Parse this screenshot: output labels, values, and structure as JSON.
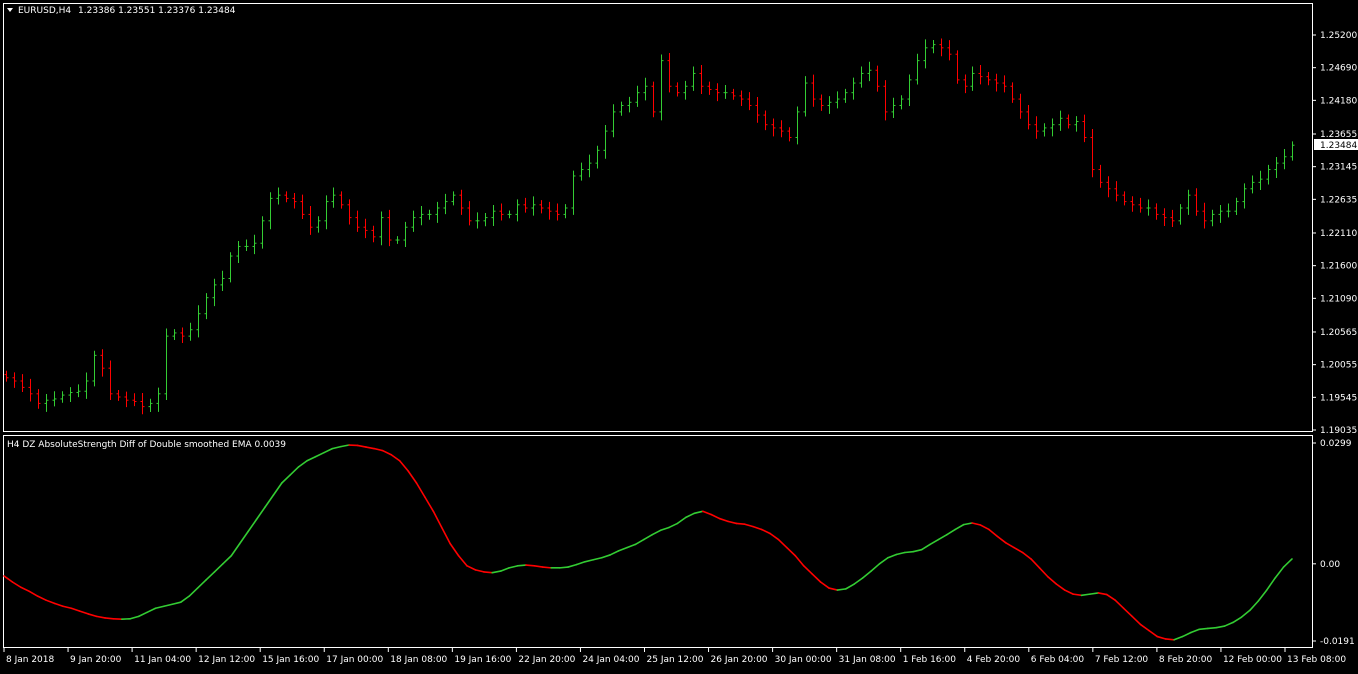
{
  "main_window": {
    "symbol": "EURUSD,H4",
    "ohlc": "1.23386 1.23551 1.23376 1.23484",
    "current_price": "1.23484",
    "price_ticks": [
      "1.25200",
      "1.24690",
      "1.24180",
      "1.23655",
      "1.23145",
      "1.22635",
      "1.22110",
      "1.21600",
      "1.21090",
      "1.20565",
      "1.20055",
      "1.19545",
      "1.19035"
    ]
  },
  "indicator_window": {
    "title": "H4 DZ AbsoluteStrength Diff  of Double smoothed EMA 0.0039",
    "value_ticks": [
      "0.0299",
      "0.00",
      "-0.0191"
    ]
  },
  "time_axis": [
    "8 Jan 2018",
    "9 Jan 20:00",
    "11 Jan 04:00",
    "12 Jan 12:00",
    "15 Jan 16:00",
    "17 Jan 00:00",
    "18 Jan 08:00",
    "19 Jan 16:00",
    "22 Jan 20:00",
    "24 Jan 04:00",
    "25 Jan 12:00",
    "26 Jan 20:00",
    "30 Jan 00:00",
    "31 Jan 08:00",
    "1 Feb 16:00",
    "4 Feb 20:00",
    "6 Feb 04:00",
    "7 Feb 12:00",
    "8 Feb 20:00",
    "12 Feb 00:00",
    "13 Feb 08:00"
  ],
  "colors": {
    "up": "#33cc33",
    "down": "#ff0000",
    "background": "#000000",
    "frame": "#ffffff"
  },
  "chart_data": [
    {
      "type": "bar",
      "description_key": "price",
      "ylim": [
        1.19035,
        1.252
      ],
      "close": [
        1.1985,
        1.198,
        1.197,
        1.196,
        1.1945,
        1.195,
        1.1952,
        1.1958,
        1.1962,
        1.1964,
        1.198,
        1.202,
        1.2,
        1.196,
        1.1955,
        1.195,
        1.1948,
        1.194,
        1.1945,
        1.196,
        1.205,
        1.2055,
        1.205,
        1.206,
        1.2085,
        1.211,
        1.213,
        1.214,
        1.2175,
        1.219,
        1.219,
        1.2195,
        1.223,
        1.2265,
        1.227,
        1.2265,
        1.226,
        1.224,
        1.222,
        1.223,
        1.226,
        1.227,
        1.2255,
        1.2235,
        1.222,
        1.2215,
        1.2205,
        1.2235,
        1.22,
        1.22,
        1.222,
        1.2235,
        1.224,
        1.224,
        1.225,
        1.226,
        1.227,
        1.225,
        1.223,
        1.223,
        1.2235,
        1.2245,
        1.224,
        1.224,
        1.2255,
        1.225,
        1.2255,
        1.225,
        1.2245,
        1.224,
        1.225,
        1.23,
        1.231,
        1.232,
        1.234,
        1.237,
        1.24,
        1.241,
        1.2415,
        1.243,
        1.244,
        1.24,
        1.248,
        1.244,
        1.243,
        1.244,
        1.246,
        1.244,
        1.2435,
        1.243,
        1.243,
        1.2425,
        1.242,
        1.241,
        1.2395,
        1.238,
        1.2375,
        1.237,
        1.236,
        1.24,
        1.2445,
        1.242,
        1.241,
        1.2415,
        1.242,
        1.243,
        1.2445,
        1.246,
        1.2465,
        1.244,
        1.24,
        1.241,
        1.242,
        1.245,
        1.248,
        1.25,
        1.2505,
        1.25,
        1.249,
        1.245,
        1.244,
        1.246,
        1.2455,
        1.245,
        1.2445,
        1.244,
        1.242,
        1.24,
        1.238,
        1.237,
        1.2375,
        1.238,
        1.239,
        1.238,
        1.2385,
        1.236,
        1.231,
        1.229,
        1.228,
        1.227,
        1.226,
        1.2255,
        1.225,
        1.225,
        1.224,
        1.2235,
        1.223,
        1.225,
        1.227,
        1.2245,
        1.223,
        1.224,
        1.2245,
        1.2245,
        1.226,
        1.228,
        1.229,
        1.2295,
        1.231,
        1.232,
        1.233,
        1.2348
      ]
    },
    {
      "type": "line",
      "description_key": "indicator",
      "ylim": [
        -0.0191,
        0.0299
      ],
      "values": [
        -0.003,
        -0.0045,
        -0.0058,
        -0.0068,
        -0.008,
        -0.009,
        -0.0098,
        -0.0105,
        -0.011,
        -0.0117,
        -0.0124,
        -0.013,
        -0.0134,
        -0.0136,
        -0.0137,
        -0.0136,
        -0.013,
        -0.012,
        -0.011,
        -0.0105,
        -0.01,
        -0.0095,
        -0.008,
        -0.006,
        -0.004,
        -0.002,
        0.0,
        0.002,
        0.005,
        0.008,
        0.011,
        0.014,
        0.017,
        0.02,
        0.022,
        0.024,
        0.0255,
        0.0265,
        0.0275,
        0.0285,
        0.029,
        0.0294,
        0.0293,
        0.0289,
        0.0285,
        0.028,
        0.027,
        0.0255,
        0.023,
        0.02,
        0.0165,
        0.013,
        0.009,
        0.005,
        0.002,
        -0.0005,
        -0.0015,
        -0.002,
        -0.0022,
        -0.0018,
        -0.001,
        -0.0005,
        -0.0003,
        -0.0005,
        -0.0008,
        -0.001,
        -0.001,
        -0.0008,
        -0.0002,
        0.0005,
        0.001,
        0.0015,
        0.0022,
        0.0032,
        0.004,
        0.0048,
        0.006,
        0.0072,
        0.0083,
        0.009,
        0.01,
        0.0115,
        0.0125,
        0.013,
        0.0122,
        0.0112,
        0.0105,
        0.01,
        0.0098,
        0.0092,
        0.0085,
        0.0075,
        0.006,
        0.004,
        0.002,
        -0.0005,
        -0.0025,
        -0.0045,
        -0.006,
        -0.0065,
        -0.0062,
        -0.005,
        -0.0035,
        -0.0018,
        0.0,
        0.0015,
        0.0023,
        0.0028,
        0.003,
        0.0035,
        0.0048,
        0.006,
        0.0072,
        0.0085,
        0.0097,
        0.0101,
        0.0096,
        0.0085,
        0.0068,
        0.0052,
        0.004,
        0.0028,
        0.0012,
        -0.001,
        -0.0032,
        -0.005,
        -0.0065,
        -0.0075,
        -0.0078,
        -0.0075,
        -0.0072,
        -0.0076,
        -0.009,
        -0.011,
        -0.013,
        -0.015,
        -0.0165,
        -0.018,
        -0.0186,
        -0.0188,
        -0.018,
        -0.017,
        -0.0162,
        -0.016,
        -0.0158,
        -0.0154,
        -0.0145,
        -0.0132,
        -0.0115,
        -0.0092,
        -0.0065,
        -0.0035,
        -0.0008,
        0.0012
      ]
    }
  ]
}
